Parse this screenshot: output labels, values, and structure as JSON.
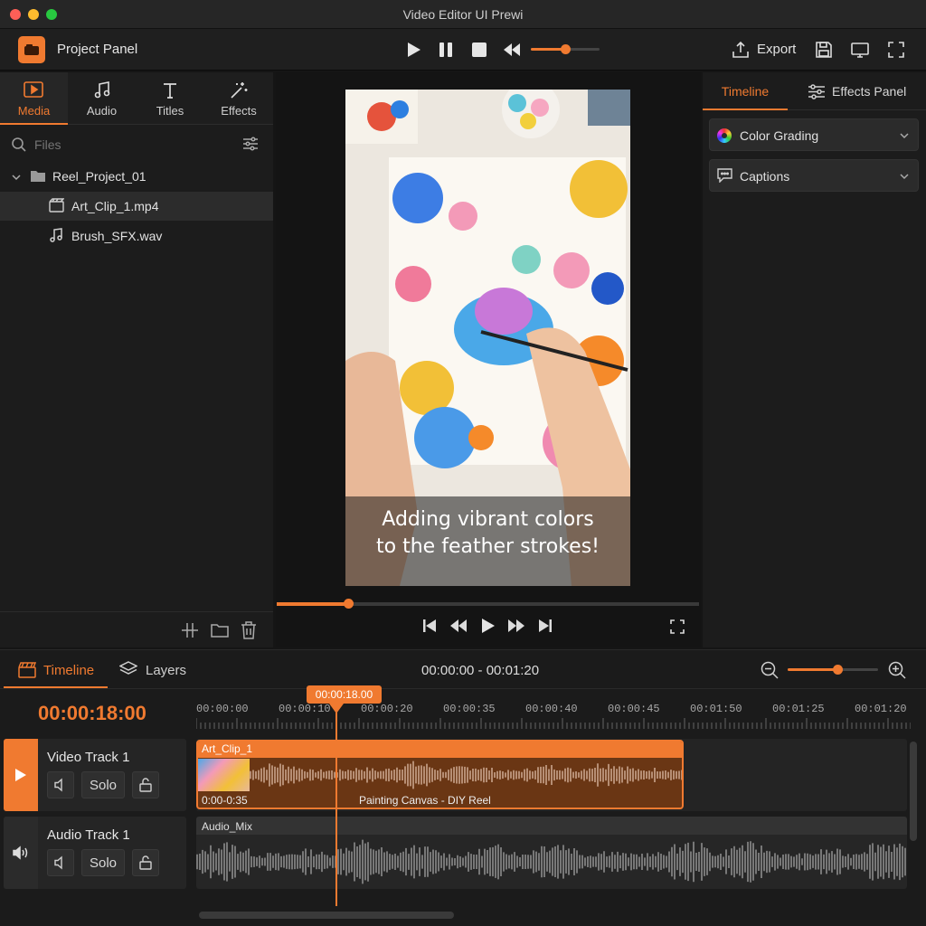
{
  "window": {
    "title": "Video Editor UI Prewi"
  },
  "toolbar": {
    "project_label": "Project Panel",
    "export_label": "Export",
    "volume_level": 0.5
  },
  "left_panel": {
    "tabs": [
      {
        "label": "Media",
        "icon": "media-play-icon",
        "active": true
      },
      {
        "label": "Audio",
        "icon": "music-note-icon"
      },
      {
        "label": "Titles",
        "icon": "text-icon"
      },
      {
        "label": "Effects",
        "icon": "magic-wand-icon"
      }
    ],
    "search_placeholder": "Files",
    "tree": {
      "folder": "Reel_Project_01",
      "files": [
        {
          "name": "Art_Clip_1.mp4",
          "icon": "video-file-icon",
          "selected": true
        },
        {
          "name": "Brush_SFX.wav",
          "icon": "audio-file-icon"
        }
      ]
    }
  },
  "preview": {
    "caption_line1": "Adding vibrant colors",
    "caption_line2": "to the feather strokes!",
    "progress": 0.17
  },
  "right_panel": {
    "tabs": [
      "Timeline",
      "Effects Panel"
    ],
    "sections": [
      "Color Grading",
      "Captions"
    ]
  },
  "timeline": {
    "tabs": [
      "Timeline",
      "Layers"
    ],
    "range": "00:00:00 - 00:01:20",
    "current_time": "00:00:18:00",
    "playhead_label": "00:00:18.00",
    "ruler": [
      "00:00:00",
      "00:00:10",
      "00:00:20",
      "00:00:35",
      "00:00:40",
      "00:00:45",
      "00:01:50",
      "00:01:25",
      "00:01:20"
    ],
    "tracks": [
      {
        "name": "Video Track 1",
        "solo": "Solo",
        "clip_name": "Art_Clip_1",
        "clip_range": "0:00-0:35",
        "clip_title": "Painting Canvas - DIY Reel"
      },
      {
        "name": "Audio Track 1",
        "solo": "Solo",
        "clip_name": "Audio_Mix"
      }
    ],
    "zoom_level": 0.55
  },
  "colors": {
    "accent": "#f07a30",
    "bg": "#151515",
    "panel": "#1c1c1c"
  }
}
